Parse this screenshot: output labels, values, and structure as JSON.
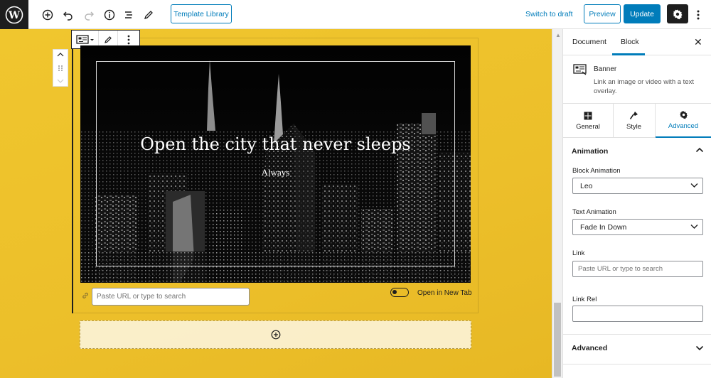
{
  "toolbar": {
    "template_library": "Template Library",
    "switch_to_draft": "Switch to draft",
    "preview": "Preview",
    "update": "Update"
  },
  "banner": {
    "title": "Open the city that never sleeps",
    "subtitle": "Always"
  },
  "link_bar": {
    "url_placeholder": "Paste URL or type to search",
    "new_tab_label": "Open in New Tab",
    "new_tab_enabled": false
  },
  "sidebar": {
    "tabs": [
      "Document",
      "Block"
    ],
    "active_tab": "Block",
    "block": {
      "name": "Banner",
      "description": "Link an image or video with a text overlay."
    },
    "setting_tabs": [
      "General",
      "Style",
      "Advanced"
    ],
    "active_setting_tab": "Advanced",
    "animation": {
      "heading": "Animation",
      "block_animation_label": "Block Animation",
      "block_animation_value": "Leo",
      "text_animation_label": "Text Animation",
      "text_animation_value": "Fade In Down",
      "link_label": "Link",
      "link_placeholder": "Paste URL or type to search",
      "link_rel_label": "Link Rel",
      "link_rel_value": ""
    },
    "advanced_heading": "Advanced"
  },
  "colors": {
    "accent": "#007cba",
    "canvas_bg": "#ecbf2a",
    "dark": "#1e1e1e"
  }
}
